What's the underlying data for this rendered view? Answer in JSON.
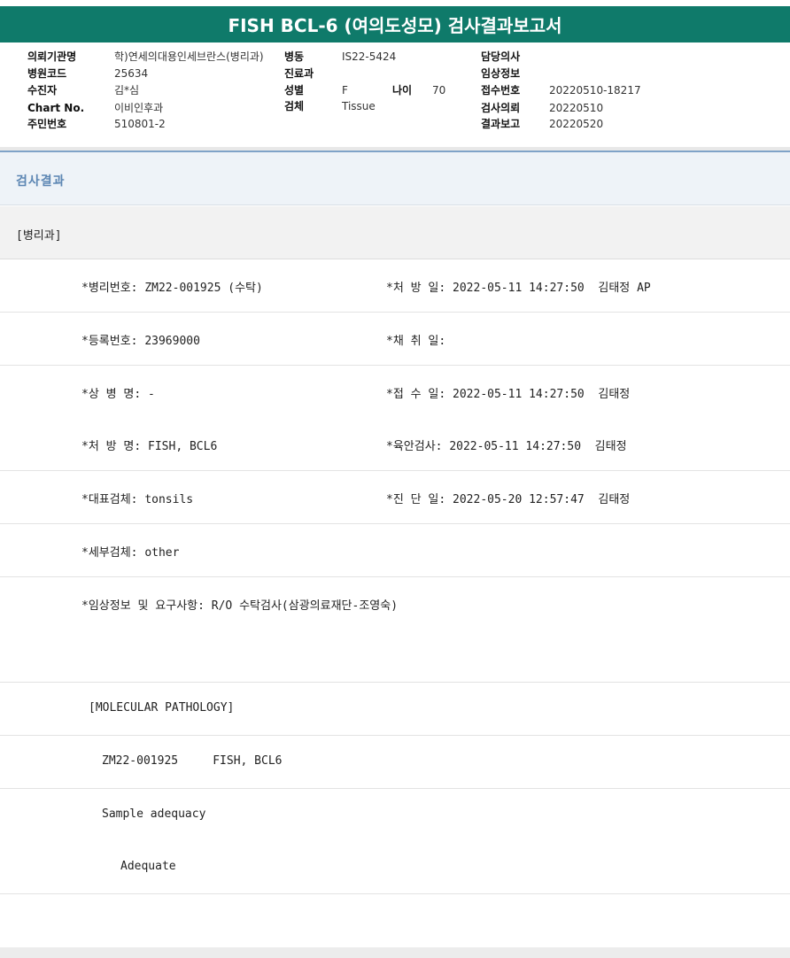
{
  "title": "FISH BCL-6 (여의도성모) 검사결과보고서",
  "header_info": {
    "institution_label": "의뢰기관명",
    "institution_value": "학)연세의대용인세브란스(병리과)",
    "ward_label": "병동",
    "ward_value": "IS22-5424",
    "doctor_label": "담당의사",
    "doctor_value": "",
    "hospital_code_label": "병원코드",
    "hospital_code_value": "25634",
    "dept_label": "진료과",
    "dept_value": "",
    "clinical_label": "임상정보",
    "clinical_value": "",
    "patient_label": "수진자",
    "patient_value": "김*심",
    "sex_label": "성별",
    "sex_value": "F",
    "age_label": "나이",
    "age_value": "70",
    "reception_label": "접수번호",
    "reception_value": "20220510-18217",
    "chart_label": "Chart No.",
    "chart_value": "이비인후과",
    "specimen_label": "검체",
    "specimen_value": "Tissue",
    "request_label": "검사의뢰",
    "request_value": "20220510",
    "rrn_label": "주민번호",
    "rrn_value": "510801-2",
    "report_label": "결과보고",
    "report_value": "20220520"
  },
  "panel_title": "검사결과",
  "department": "[병리과]",
  "rows": [
    {
      "left": "*병리번호: ZM22-001925 (수탁)",
      "right": "*처 방 일: 2022-05-11 14:27:50  김태정 AP"
    },
    {
      "left": "*등록번호: 23969000",
      "right": "*채 취 일:"
    },
    {
      "left": "*상 병 명: -",
      "right": "*접 수 일: 2022-05-11 14:27:50  김태정"
    },
    {
      "left": "*처 방 명: FISH, BCL6",
      "right": "*육안검사: 2022-05-11 14:27:50  김태정"
    },
    {
      "left": "*대표검체: tonsils",
      "right": "*진 단 일: 2022-05-20 12:57:47  김태정"
    },
    {
      "left": "*세부검체: other",
      "right": ""
    },
    {
      "left": "*임상정보 및 요구사항: R/O 수탁검사(삼광의료재단-조영숙)",
      "right": ""
    },
    {
      "left": "",
      "right": ""
    }
  ],
  "result_lines": [
    "[MOLECULAR PATHOLOGY]",
    "ZM22-001925     FISH, BCL6",
    "Sample adequacy",
    "Adequate",
    ""
  ]
}
